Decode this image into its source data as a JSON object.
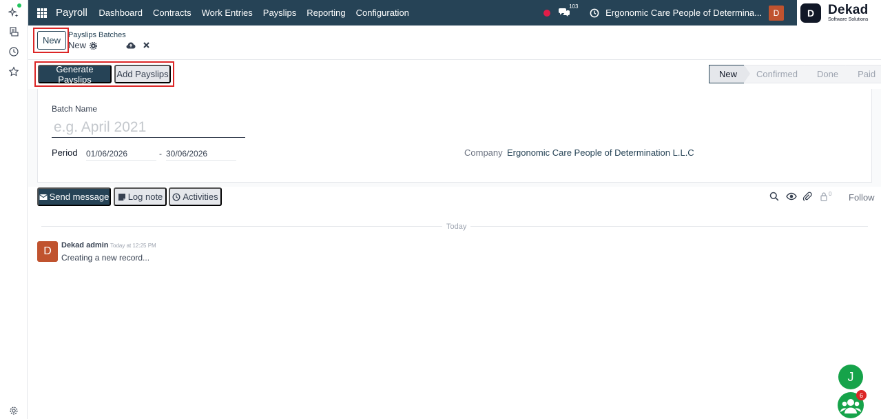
{
  "navbar": {
    "app_name": "Payroll",
    "menu": [
      "Dashboard",
      "Contracts",
      "Work Entries",
      "Payslips",
      "Reporting",
      "Configuration"
    ],
    "message_count": "103",
    "company": "Ergonomic Care People of Determina...",
    "user_initial": "D",
    "brand_name": "Dekad",
    "brand_tagline": "Software Solutions",
    "brand_mark": "D"
  },
  "control": {
    "new_label": "New",
    "breadcrumb_parent": "Payslips Batches",
    "breadcrumb_current": "New"
  },
  "actions": {
    "generate_label": "Generate Payslips",
    "add_label": "Add Payslips"
  },
  "status": {
    "stages": [
      "New",
      "Confirmed",
      "Done",
      "Paid"
    ],
    "active": "New"
  },
  "form": {
    "batch_name_label": "Batch Name",
    "batch_name_placeholder": "e.g. April 2021",
    "batch_name_value": "",
    "period_label": "Period",
    "date_from": "01/06/2026",
    "date_separator": "-",
    "date_to": "30/06/2026",
    "company_label": "Company",
    "company_value": "Ergonomic Care People of Determination L.L.C"
  },
  "chatter": {
    "send_label": "Send message",
    "log_label": "Log note",
    "activities_label": "Activities",
    "follower_count": "0",
    "follow_label": "Follow",
    "date_divider": "Today",
    "message": {
      "author_initial": "D",
      "author": "Dekad admin",
      "time": "Today at 12:25 PM",
      "body": "Creating a new record..."
    }
  },
  "floating": {
    "chat_initial": "J",
    "team_badge": "6"
  },
  "colors": {
    "primary": "#264356",
    "avatar": "#c0532f",
    "highlight": "#dc2626",
    "fab": "#16a34a"
  }
}
